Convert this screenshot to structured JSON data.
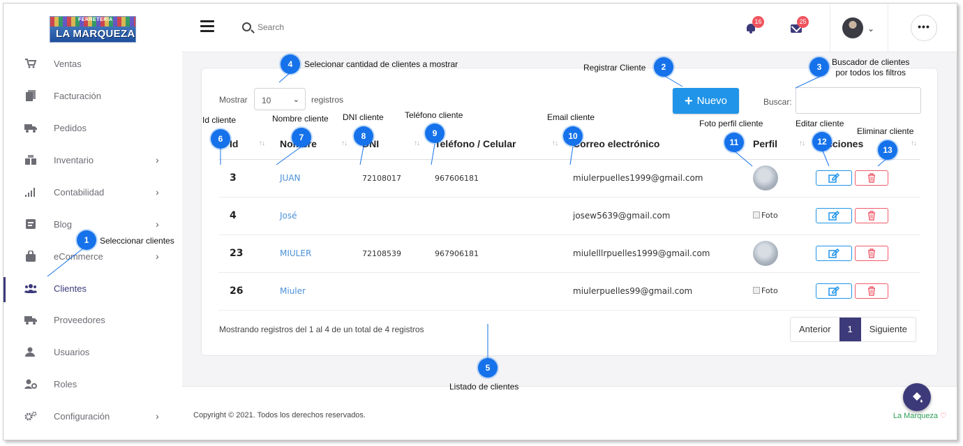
{
  "logo": {
    "top": "FERRETERIA",
    "name": "LA MARQUEZA"
  },
  "sidebar": {
    "items": [
      {
        "label": "Ventas",
        "icon": "cart-icon",
        "chevron": false
      },
      {
        "label": "Facturación",
        "icon": "document-icon",
        "chevron": false
      },
      {
        "label": "Pedidos",
        "icon": "truck-icon",
        "chevron": false
      },
      {
        "label": "Inventario",
        "icon": "inventory-icon",
        "chevron": true
      },
      {
        "label": "Contabilidad",
        "icon": "bar-chart-icon",
        "chevron": true
      },
      {
        "label": "Blog",
        "icon": "blog-icon",
        "chevron": true
      },
      {
        "label": "eCommerce",
        "icon": "bag-icon",
        "chevron": true
      },
      {
        "label": "Clientes",
        "icon": "users-icon",
        "chevron": false,
        "active": true
      },
      {
        "label": "Proveedores",
        "icon": "truck-icon",
        "chevron": false
      },
      {
        "label": "Usuarios",
        "icon": "user-icon",
        "chevron": false
      },
      {
        "label": "Roles",
        "icon": "user-gear-icon",
        "chevron": false
      },
      {
        "label": "Configuración",
        "icon": "gears-icon",
        "chevron": true
      }
    ],
    "chevron": "›"
  },
  "topbar": {
    "search_placeholder": "Search",
    "notifications_count": "16",
    "messages_count": "25",
    "user_chevron": "⌄",
    "more_label": "•••"
  },
  "card": {
    "show_label": "Mostrar",
    "show_value": "10",
    "registros_label": "registros",
    "nuevo_label": "Nuevo",
    "buscar_label": "Buscar:",
    "columns": [
      "Id",
      "Nombre",
      "DNI",
      "Teléfono / Celular",
      "Correo electrónico",
      "Perfil",
      "Acciones"
    ],
    "rows": [
      {
        "id": "3",
        "name": "JUAN",
        "dni": "72108017",
        "tel": "967606181",
        "email": "miulerpuelles1999@gmail.com",
        "perfil": "image"
      },
      {
        "id": "4",
        "name": "José",
        "dni": "",
        "tel": "",
        "email": "josew5639@gmail.com",
        "perfil": "Foto"
      },
      {
        "id": "23",
        "name": "MIULER",
        "dni": "72108539",
        "tel": "967906181",
        "email": "miulelllrpuelles1999@gmail.com",
        "perfil": "image"
      },
      {
        "id": "26",
        "name": "Miuler",
        "dni": "",
        "tel": "",
        "email": "miulerpuelles99@gmail.com",
        "perfil": "Foto"
      }
    ],
    "info": "Mostrando registros del 1 al 4 de un total de 4 registros",
    "pager": {
      "prev": "Anterior",
      "current": "1",
      "next": "Siguiente"
    }
  },
  "footer": {
    "copyright": "Copyright © 2021. Todos los derechos reservados.",
    "brand": "La Marqueza",
    "heart": "♡"
  },
  "callouts": [
    {
      "num": "1",
      "text": "Seleccionar clientes"
    },
    {
      "num": "2",
      "text": "Registrar Cliente"
    },
    {
      "num": "3",
      "text": "Buscador de clientes\npor todos los filtros"
    },
    {
      "num": "4",
      "text": "Selecionar cantidad de clientes a mostrar"
    },
    {
      "num": "5",
      "text": "Listado de clientes"
    },
    {
      "num": "6",
      "text": "Id cliente"
    },
    {
      "num": "7",
      "text": "Nombre cliente"
    },
    {
      "num": "8",
      "text": "DNI cliente"
    },
    {
      "num": "9",
      "text": "Teléfono cliente"
    },
    {
      "num": "10",
      "text": "Email cliente"
    },
    {
      "num": "11",
      "text": "Foto perfil cliente"
    },
    {
      "num": "12",
      "text": "Editar cliente"
    },
    {
      "num": "13",
      "text": "Eliminar cliente"
    }
  ],
  "colors": {
    "accent": "#3d3a7a",
    "primary": "#1f94e8",
    "danger": "#f05b6a",
    "callout": "#1572ea"
  }
}
